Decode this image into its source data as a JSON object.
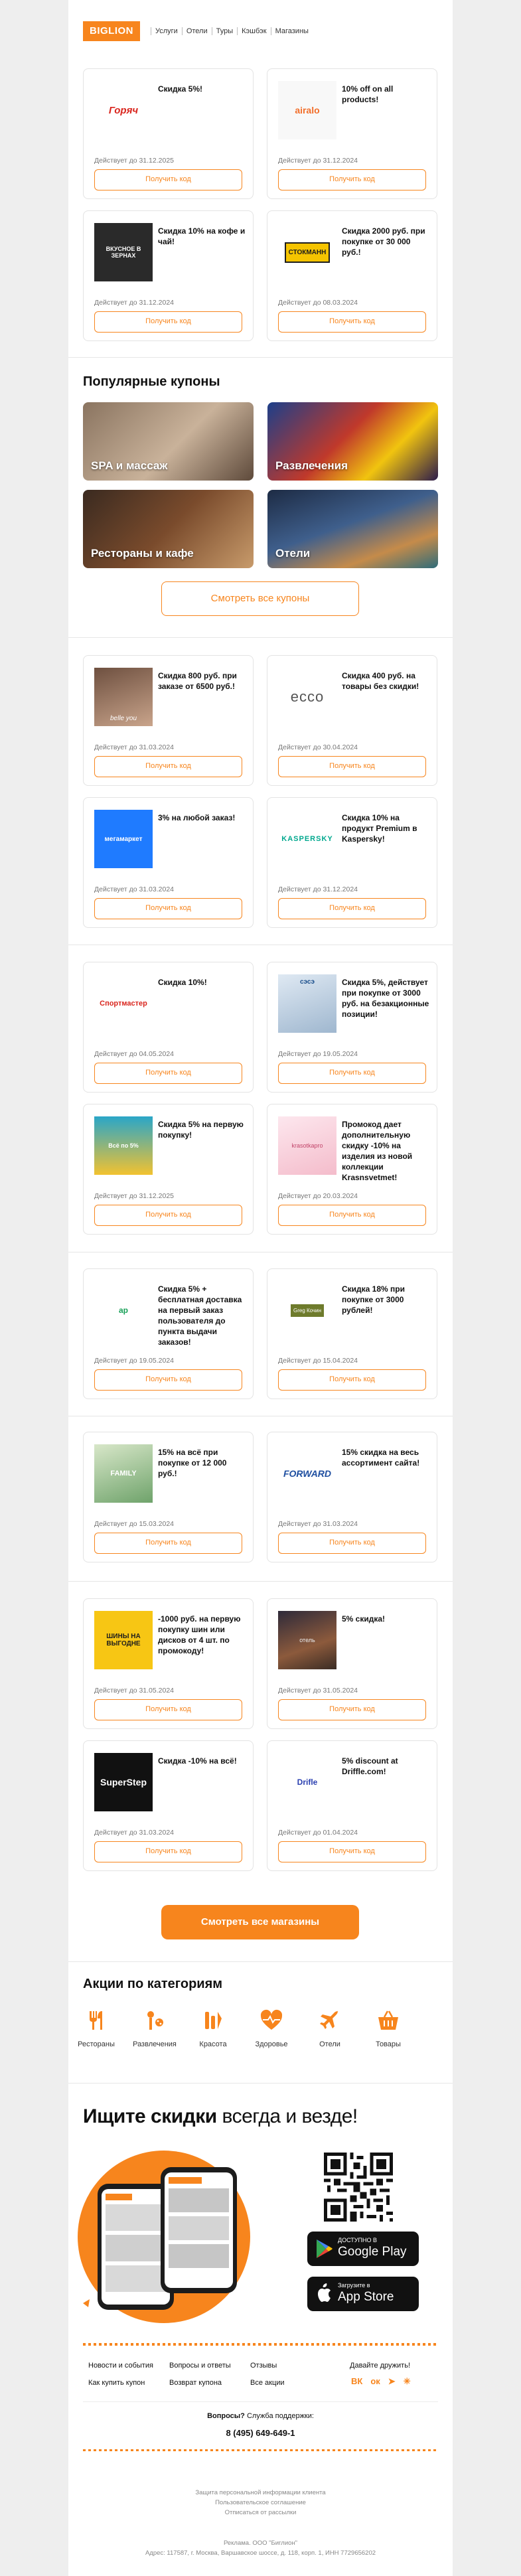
{
  "header": {
    "logo": "BIGLION",
    "nav": [
      "Услуги",
      "Отели",
      "Туры",
      "Кэшбэк",
      "Магазины"
    ]
  },
  "coupon_button": "Получить код",
  "group1": [
    {
      "brand": "Горяч",
      "title": "Скидка 5%!",
      "valid": "Действует до 31.12.2025"
    },
    {
      "brand": "airalo",
      "title": "10% off on all products!",
      "valid": "Действует до 31.12.2024"
    },
    {
      "brand": "ВКУСНОЕ В ЗЕРНАХ",
      "title": "Скидка 10% на кофе и чай!",
      "valid": "Действует до 31.12.2024"
    },
    {
      "brand": "СТОКМАНН",
      "title": "Скидка 2000 руб. при покупке от 30 000 руб.!",
      "valid": "Действует до 08.03.2024"
    }
  ],
  "popular": {
    "heading": "Популярные купоны",
    "categories": [
      "SPA и массаж",
      "Развлечения",
      "Рестораны и кафе",
      "Отели"
    ],
    "all_button": "Смотреть все купоны"
  },
  "group2": [
    {
      "brand": "belle you",
      "title": "Скидка 800 руб. при заказе от 6500 руб.!",
      "valid": "Действует до 31.03.2024"
    },
    {
      "brand": "ecco",
      "title": "Скидка 400 руб. на товары без скидки!",
      "valid": "Действует до 30.04.2024"
    },
    {
      "brand": "мегамаркет",
      "title": "3% на любой заказ!",
      "valid": "Действует до 31.03.2024"
    },
    {
      "brand": "KASPERSKY",
      "title": "Скидка 10% на продукт Premium в Kaspersky!",
      "valid": "Действует до 31.12.2024"
    }
  ],
  "group3": [
    {
      "brand": "Спортмастер",
      "title": "Скидка 10%!",
      "valid": "Действует до 04.05.2024"
    },
    {
      "brand": "сэсэ",
      "title": "Скидка 5%, действует при покупке от 3000 руб. на безакционные позиции!",
      "valid": "Действует до 19.05.2024"
    },
    {
      "brand": "Всё по 5%",
      "title": "Скидка 5% на первую покупку!",
      "valid": "Действует до 31.12.2025"
    },
    {
      "brand": "krasotkapro",
      "title": "Промокод дает дополнительную скидку -10% на изделия из новой коллекции Krasnsvetmet!",
      "valid": "Действует до 20.03.2024"
    }
  ],
  "group4": [
    {
      "brand": "ap",
      "title": "Скидка 5% + бесплатная доставка на первый заказ пользователя до пункта выдачи заказов!",
      "valid": "Действует до 19.05.2024"
    },
    {
      "brand": "Greg Кочин",
      "title": "Скидка 18% при покупке от 3000 рублей!",
      "valid": "Действует до 15.04.2024"
    }
  ],
  "group5": [
    {
      "brand": "FAMILY",
      "title": "15% на всё при покупке от 12 000 руб.!",
      "valid": "Действует до 15.03.2024"
    },
    {
      "brand": "FORWARD",
      "title": "15% скидка на весь ассортимент сайта!",
      "valid": "Действует до 31.03.2024"
    }
  ],
  "group6": [
    {
      "brand": "ШИНЫ НА ВЫГОДНЕ",
      "title": "-1000 руб. на первую покупку шин или дисков от 4 шт. по промокоду!",
      "valid": "Действует до 31.05.2024"
    },
    {
      "brand": "отель",
      "title": "5% скидка!",
      "valid": "Действует до 31.05.2024"
    },
    {
      "brand": "SuperStep",
      "title": "Скидка -10% на всё!",
      "valid": "Действует до 31.03.2024"
    },
    {
      "brand": "Drifle",
      "title": "5% discount at Driffle.com!",
      "valid": "Действует до 01.04.2024"
    }
  ],
  "stores_button": "Смотреть все магазины",
  "categories": {
    "heading": "Акции по категориям",
    "items": [
      {
        "label": "Рестораны",
        "icon": "restaurant-icon"
      },
      {
        "label": "Развлечения",
        "icon": "entertainment-icon"
      },
      {
        "label": "Красота",
        "icon": "beauty-icon"
      },
      {
        "label": "Здоровье",
        "icon": "health-icon"
      },
      {
        "label": "Отели",
        "icon": "plane-icon"
      },
      {
        "label": "Товары",
        "icon": "basket-icon"
      }
    ]
  },
  "app": {
    "heading_bold": "Ищите скидки",
    "heading_rest": " всегда и везде!",
    "gplay_small": "ДОСТУПНО В",
    "gplay_big": "Google Play",
    "appstore_small": "Загрузите в",
    "appstore_big": "App Store"
  },
  "footer": {
    "links": [
      [
        "Новости и события",
        "Вопросы и ответы",
        "Отзывы"
      ],
      [
        "Как купить купон",
        "Возврат купона",
        "Все акции"
      ]
    ],
    "friends": "Давайте дружить!",
    "support_q": "Вопросы?",
    "support_text": "Служба поддержки:",
    "phone": "8 (495) 649-649-1",
    "legal": [
      "Защита персональной информации клиента",
      "Пользовательское соглашение",
      "Отписаться от рассылки"
    ],
    "company": "Реклама. ООО \"Биглион\"",
    "address": "Адрес: 117587, г. Москва, Варшавское шоссе, д. 118, корп. 1, ИНН 7729656202"
  },
  "colors": {
    "accent": "#f7851d"
  }
}
